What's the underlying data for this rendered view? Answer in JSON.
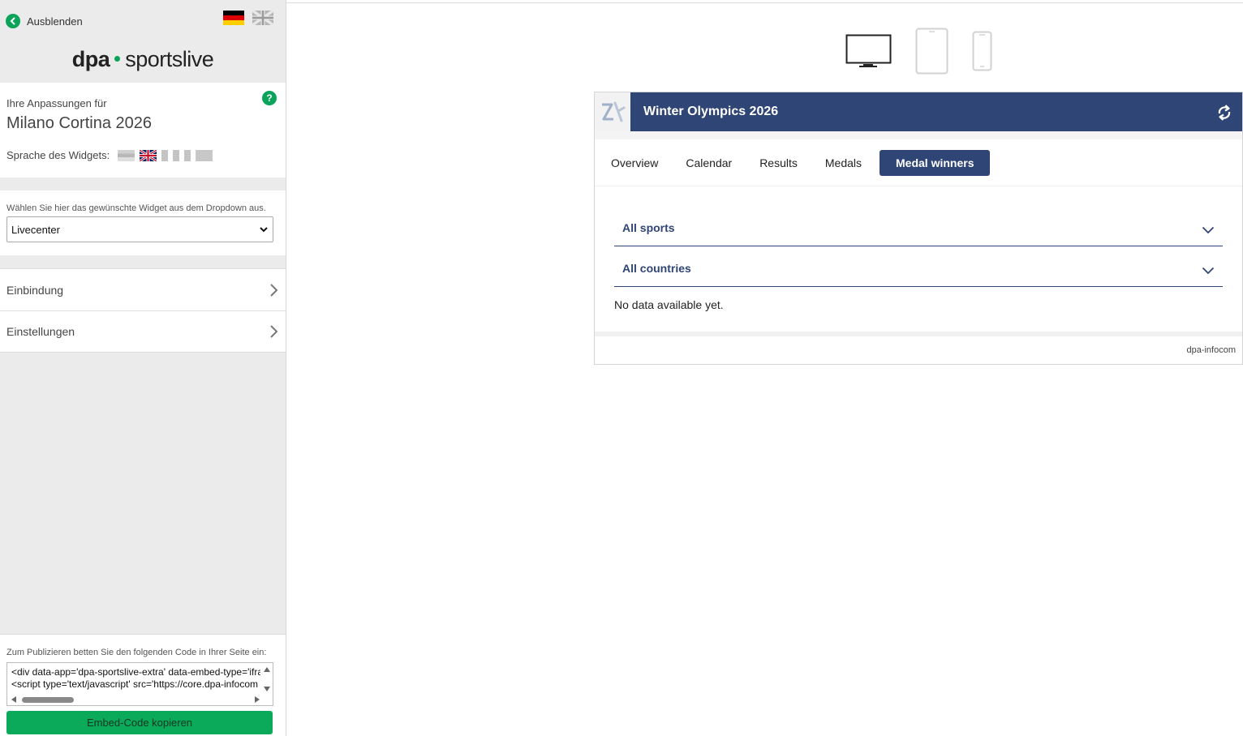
{
  "sidebar": {
    "hide_label": "Ausblenden",
    "logo_dpa": "dpa",
    "logo_sportslive": "sportslive",
    "customization_label": "Ihre Anpassungen für",
    "event_name": "Milano Cortina 2026",
    "help_label": "?",
    "widget_language_label": "Sprache des Widgets:",
    "widget_select_hint": "Wählen Sie hier das gewünschte Widget aus dem Dropdown aus.",
    "widget_select_value": "Livecenter",
    "menu": [
      {
        "label": "Einbindung"
      },
      {
        "label": "Einstellungen"
      }
    ],
    "publish_hint": "Zum Publizieren betten Sie den folgenden Code in Ihrer Seite ein:",
    "code_lines": [
      "<div data-app='dpa-sportslive-extra' data-embed-type='ifra",
      "<script type='text/javascript' src='https://core.dpa-infocom"
    ],
    "copy_button": "Embed-Code kopieren"
  },
  "widget": {
    "title": "Winter Olympics 2026",
    "tabs": [
      {
        "label": "Overview"
      },
      {
        "label": "Calendar"
      },
      {
        "label": "Results"
      },
      {
        "label": "Medals"
      },
      {
        "label": "Medal winners"
      }
    ],
    "active_tab": "Medal winners",
    "filters": [
      {
        "label": "All sports"
      },
      {
        "label": "All countries"
      }
    ],
    "empty_message": "No data available yet.",
    "footer": "dpa-infocom"
  },
  "colors": {
    "accent_green": "#0aa35a",
    "widget_navy": "#2f4576"
  }
}
